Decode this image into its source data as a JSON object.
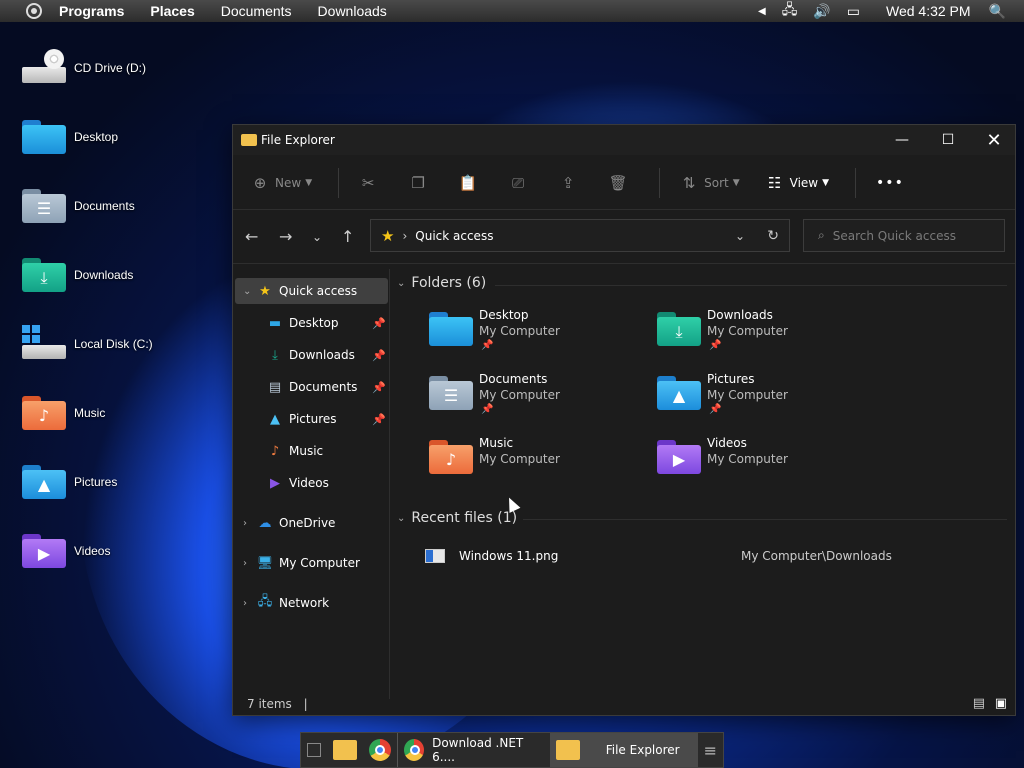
{
  "top_panel": {
    "menus": [
      "Programs",
      "Places",
      "Documents",
      "Downloads"
    ],
    "clock": "Wed 4:32 PM",
    "icons": [
      "activities-icon",
      "arrow-left-icon",
      "network-icon",
      "volume-icon",
      "notification-icon",
      "search-icon"
    ]
  },
  "desktop": {
    "icons": [
      {
        "label": "CD Drive (D:)",
        "icon": "cd-drive-icon"
      },
      {
        "label": "Desktop",
        "icon": "desktop-folder-icon"
      },
      {
        "label": "Documents",
        "icon": "documents-folder-icon"
      },
      {
        "label": "Downloads",
        "icon": "downloads-folder-icon"
      },
      {
        "label": "Local Disk (C:)",
        "icon": "local-disk-icon"
      },
      {
        "label": "Music",
        "icon": "music-folder-icon"
      },
      {
        "label": "Pictures",
        "icon": "pictures-folder-icon"
      },
      {
        "label": "Videos",
        "icon": "videos-folder-icon"
      }
    ]
  },
  "window": {
    "title": "File Explorer",
    "toolbar": {
      "new": "New",
      "sort": "Sort",
      "view": "View",
      "more": "•••"
    },
    "address": {
      "location": "Quick access",
      "search_placeholder": "Search Quick access"
    },
    "nav": {
      "quick_access": "Quick access",
      "pinned": [
        "Desktop",
        "Downloads",
        "Documents",
        "Pictures"
      ],
      "others": [
        "Music",
        "Videos"
      ],
      "onedrive": "OneDrive",
      "my_computer": "My Computer",
      "network": "Network"
    },
    "folders_header": "Folders (6)",
    "folders": [
      {
        "name": "Desktop",
        "location": "My Computer",
        "pinned": true
      },
      {
        "name": "Downloads",
        "location": "My Computer",
        "pinned": true
      },
      {
        "name": "Documents",
        "location": "My Computer",
        "pinned": true
      },
      {
        "name": "Pictures",
        "location": "My Computer",
        "pinned": true
      },
      {
        "name": "Music",
        "location": "My Computer",
        "pinned": false
      },
      {
        "name": "Videos",
        "location": "My Computer",
        "pinned": false
      }
    ],
    "recent_header": "Recent files (1)",
    "recent": [
      {
        "name": "Windows 11.png",
        "path": "My Computer\\Downloads"
      }
    ],
    "status": "7 items"
  },
  "taskbar": {
    "items": [
      {
        "label": "",
        "icon": "show-desktop-icon"
      },
      {
        "label": "",
        "icon": "files-icon"
      },
      {
        "label": "",
        "icon": "chrome-icon"
      },
      {
        "label": "Download .NET 6....",
        "icon": "chrome-icon"
      },
      {
        "label": "File Explorer",
        "icon": "folder-icon"
      }
    ]
  },
  "colors": {
    "accent": "#0078d4",
    "folder_blue": "#2ea7e6",
    "folder_green": "#19a98d",
    "folder_gray": "#8fa4b8",
    "folder_orange": "#f07b3f",
    "folder_purple": "#8a55e6",
    "star": "#f5c518"
  }
}
